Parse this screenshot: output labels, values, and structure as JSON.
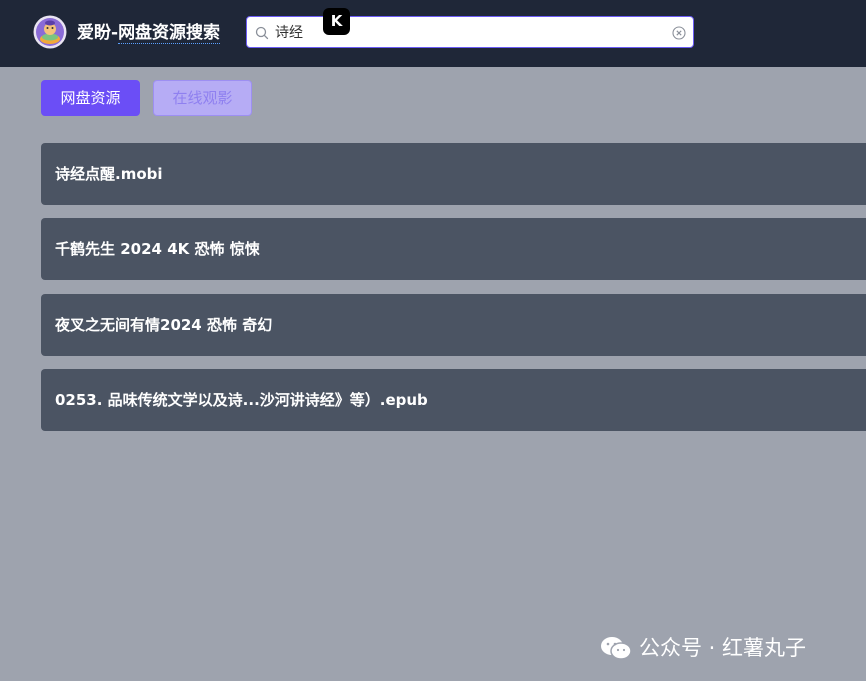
{
  "header": {
    "site_title_prefix": "爱盼-",
    "site_title_main": "网盘资源搜索",
    "logo_icon": "avatar-logo-icon"
  },
  "search": {
    "value": "诗经",
    "search_icon": "search-icon",
    "clear_icon": "clear-circle-icon"
  },
  "overlay_badge": {
    "label": "K",
    "icon": "k-app-badge-icon"
  },
  "tabs": [
    {
      "label": "网盘资源",
      "active": true
    },
    {
      "label": "在线观影",
      "active": false
    }
  ],
  "results": [
    {
      "title": "诗经点醒.mobi"
    },
    {
      "title": "千鹤先生 2024 4K 恐怖 惊悚"
    },
    {
      "title": "夜叉之无间有情2024 恐怖 奇幻"
    },
    {
      "title": "0253. 品味传统文学以及诗...沙河讲诗经》等）.epub"
    }
  ],
  "watermark": {
    "text": "公众号 · 红薯丸子",
    "icon": "wechat-icon"
  },
  "colors": {
    "header_bg": "#1f2738",
    "page_bg": "#9ea3ae",
    "accent": "#6b4ef6",
    "result_bg": "#4b5463"
  }
}
